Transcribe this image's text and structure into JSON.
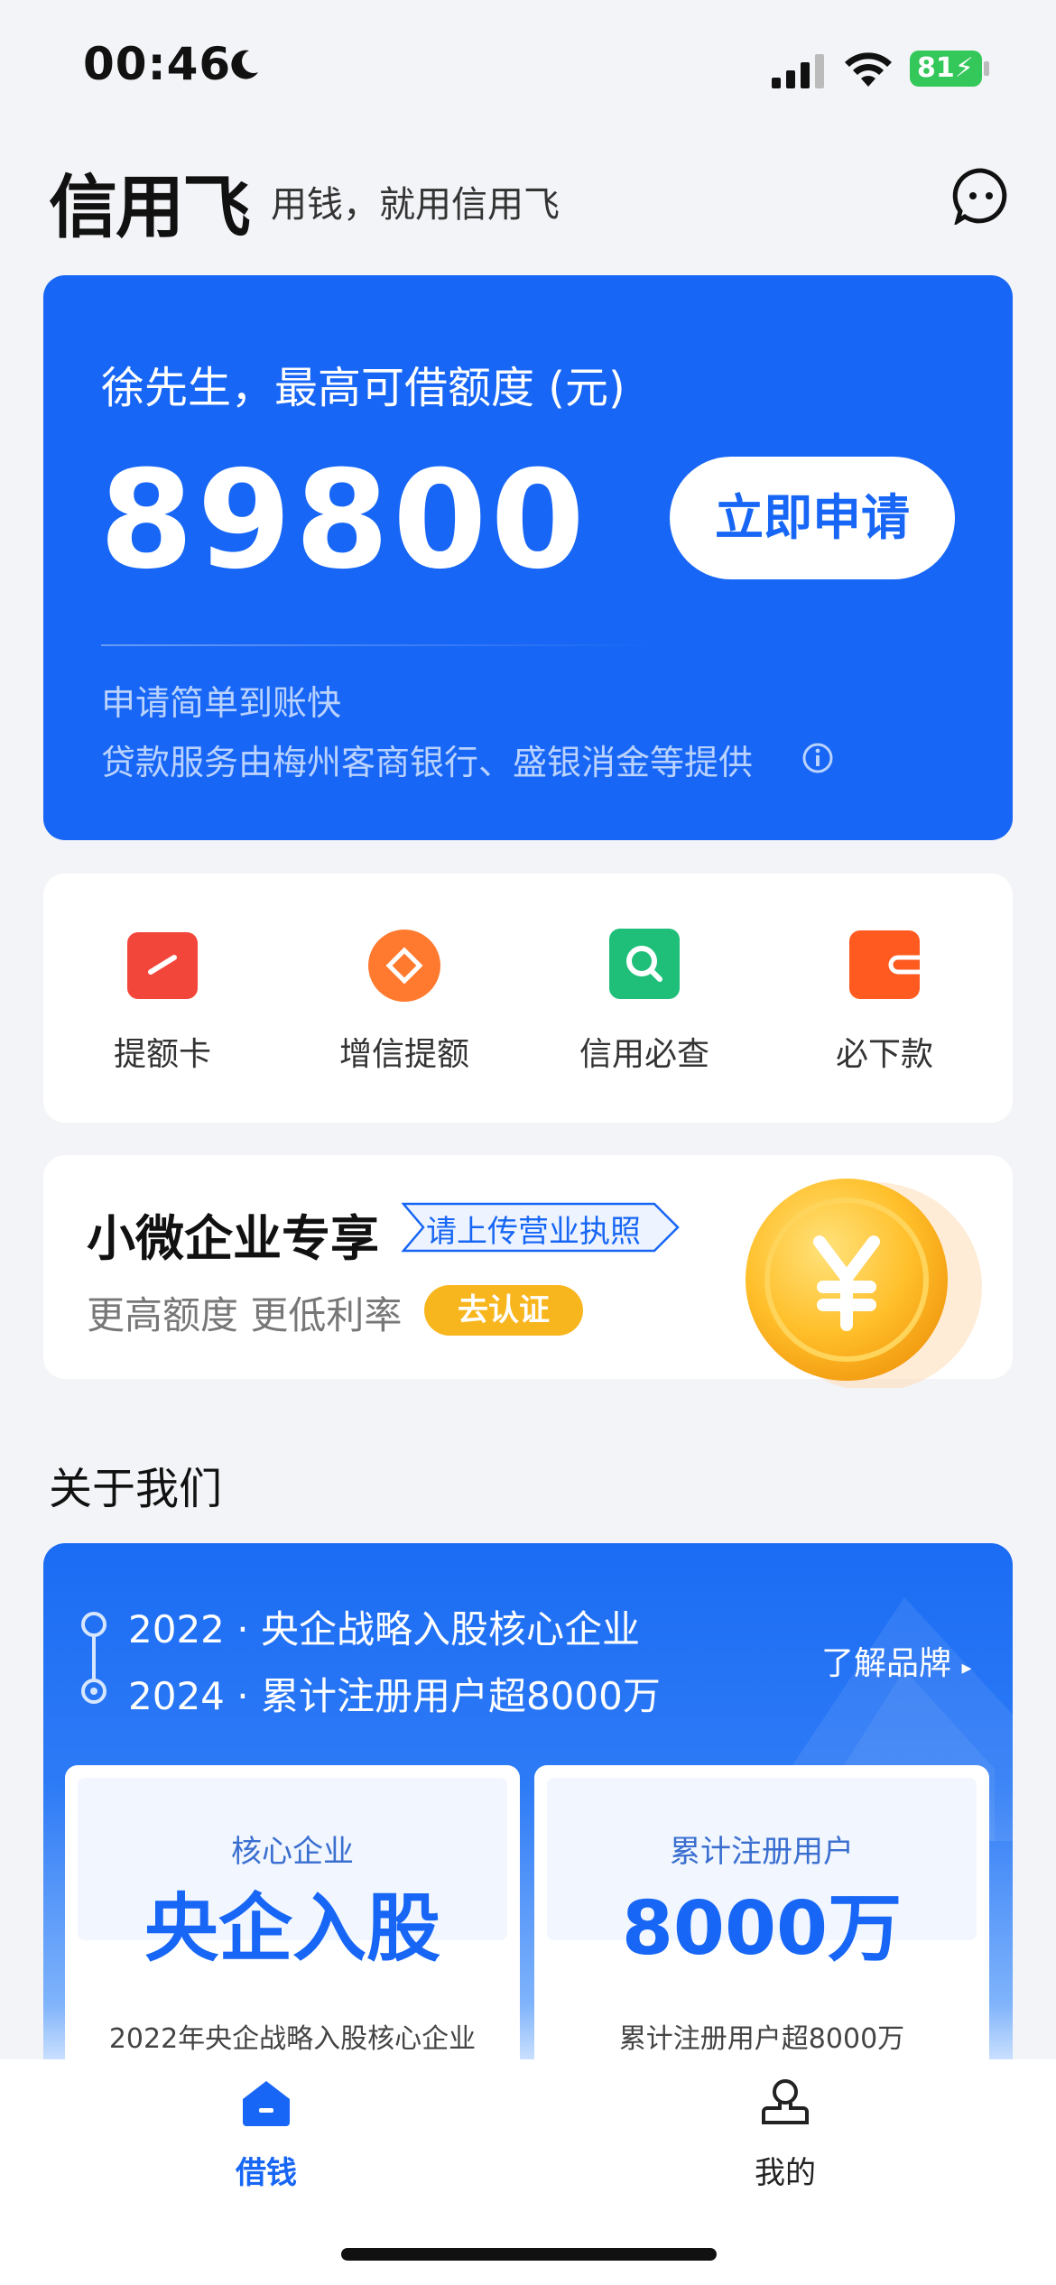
{
  "status_bar": {
    "time": "00:46",
    "battery": "81"
  },
  "header": {
    "brand": "信用飞",
    "slogan": "用钱，就用信用飞"
  },
  "loan": {
    "greeting": "徐先生，最高可借额度 (元)",
    "amount": "89800",
    "apply_label": "立即申请",
    "sub1": "申请简单到账快",
    "sub2": "贷款服务由梅州客商银行、盛银消金等提供"
  },
  "actions": [
    {
      "label": "提额卡",
      "color": "#f2463b"
    },
    {
      "label": "增信提额",
      "color": "#ff7a2f"
    },
    {
      "label": "信用必查",
      "color": "#1fbf7a"
    },
    {
      "label": "必下款",
      "color": "#ff5a1f"
    }
  ],
  "sme": {
    "title": "小微企业专享",
    "upload": "请上传营业执照",
    "subtitle": "更高额度 更低利率",
    "cert_label": "去认证"
  },
  "about": {
    "title": "关于我们",
    "line1": "2022 · 央企战略入股核心企业",
    "line2": "2024 · 累计注册用户超8000万",
    "learn_brand": "了解品牌",
    "stats": [
      {
        "small": "核心企业",
        "big": "央企入股",
        "desc": "2022年央企战略入股核心企业"
      },
      {
        "small": "累计注册用户",
        "big": "8000万",
        "desc": "累计注册用户超8000万"
      }
    ]
  },
  "tabs": [
    {
      "label": "借钱",
      "active": true
    },
    {
      "label": "我的",
      "active": false
    }
  ],
  "colors": {
    "primary": "#1766f5",
    "accent_yellow": "#f8b61e"
  }
}
